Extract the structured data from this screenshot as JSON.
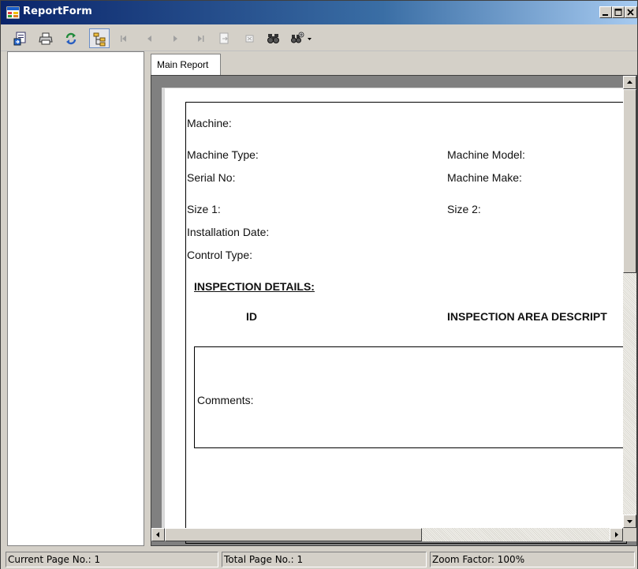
{
  "window": {
    "title": "ReportForm",
    "controls": [
      "minimize-icon",
      "maximize-icon",
      "close-icon"
    ]
  },
  "toolbar": {
    "buttons": [
      {
        "icon": "export-icon",
        "enabled": true
      },
      {
        "icon": "print-icon",
        "enabled": true
      },
      {
        "icon": "refresh-icon",
        "enabled": true
      },
      {
        "icon": "group-tree-toggle-icon",
        "enabled": true,
        "pressed": true
      },
      {
        "icon": "first-page-icon",
        "enabled": false
      },
      {
        "icon": "previous-page-icon",
        "enabled": false
      },
      {
        "icon": "next-page-icon",
        "enabled": false
      },
      {
        "icon": "last-page-icon",
        "enabled": false
      },
      {
        "icon": "goto-page-icon",
        "enabled": false
      },
      {
        "icon": "close-view-icon",
        "enabled": false
      },
      {
        "icon": "find-icon",
        "enabled": true
      },
      {
        "icon": "zoom-icon",
        "enabled": true
      }
    ]
  },
  "tabs": {
    "main_report": "Main Report"
  },
  "report": {
    "machine": "Machine:",
    "machine_type": "Machine Type:",
    "machine_model": "Machine Model:",
    "serial_no": "Serial No:",
    "machine_make": "Machine Make:",
    "size1": "Size 1:",
    "size2": "Size 2:",
    "installation_date": "Installation Date:",
    "control_type": "Control Type:",
    "inspection_details": "INSPECTION DETAILS:",
    "col_id": "ID",
    "col_area": "INSPECTION AREA DESCRIPT",
    "comments": "Comments:"
  },
  "status": {
    "current_page": "Current Page No.: 1",
    "total_page": "Total Page No.: 1",
    "zoom": "Zoom Factor: 100%"
  },
  "colors": {
    "title_bar_start": "#0a246a",
    "title_bar_end": "#a6caf0",
    "chrome": "#d4d0c8",
    "pressed_button_border": "#6b8ec6"
  }
}
